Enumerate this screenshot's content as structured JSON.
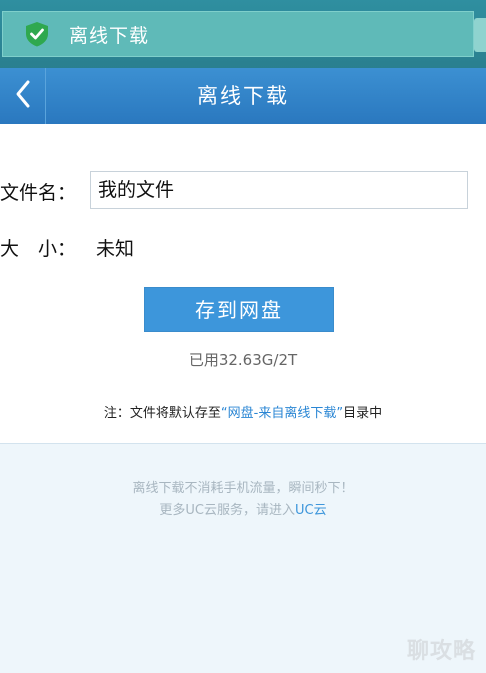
{
  "notification": {
    "icon": "check-shield-icon",
    "text": "离线下载"
  },
  "header": {
    "back_icon": "chevron-left-icon",
    "title": "离线下载"
  },
  "form": {
    "filename_label": "文件名：",
    "filename_value": "我的文件",
    "size_label": "大　小：",
    "size_value": "未知"
  },
  "actions": {
    "save_label": "存到网盘"
  },
  "quota": {
    "text": "已用32.63G/2T"
  },
  "note": {
    "prefix": "注：文件将默认存至",
    "link": "“网盘-来自离线下载”",
    "suffix": "目录中"
  },
  "footer": {
    "line1": "离线下载不消耗手机流量，瞬间秒下！",
    "line2_prefix": "更多UC云服务，请进入",
    "line2_link": "UC云"
  },
  "watermark": {
    "text": "聊攻略"
  },
  "colors": {
    "accent": "#3d96db",
    "title_bar": "#3284c8",
    "toast_bg": "#5fbab8",
    "check_green": "#2fa84f"
  }
}
